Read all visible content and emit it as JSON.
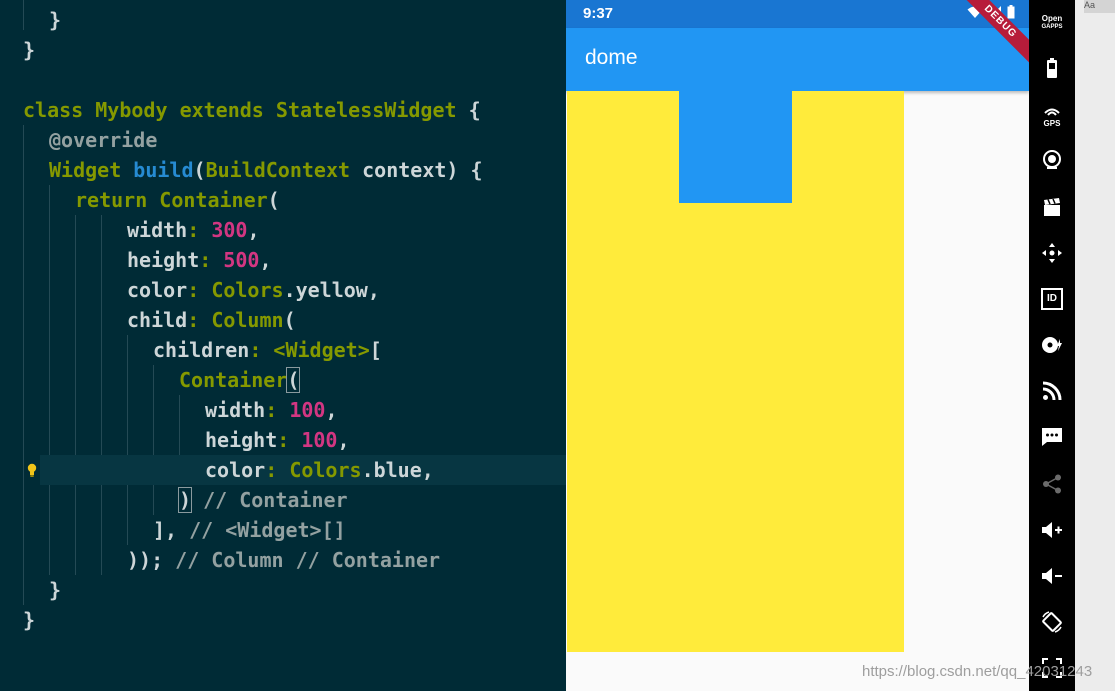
{
  "editor": {
    "tokens": {
      "brace_close": "}",
      "class_kw": "class",
      "class_name": "Mybody",
      "extends_kw": "extends",
      "super_name": "StatelessWidget",
      "open_brace": "{",
      "override": "@override",
      "widget_type": "Widget",
      "build_fn": "build",
      "paren_open": "(",
      "ctx_type": "BuildContext",
      "ctx_name": "context",
      "paren_close_brace": ") {",
      "return_kw": "return",
      "container": "Container",
      "width_key": "width",
      "height_key": "height",
      "color_key": "color",
      "child_key": "child",
      "children_key": "children",
      "colon": ":",
      "comma": ",",
      "val_300": "300",
      "val_500": "500",
      "val_100a": "100",
      "val_100b": "100",
      "colors": "Colors",
      "yellow": ".yellow,",
      "blue": ".blue,",
      "column": "Column",
      "widget_generic": "<Widget>",
      "bracket_open": "[",
      "close_paren": ")",
      "comment_container": "// Container",
      "close_list": "],",
      "comment_widget_list": "// <Widget>[]",
      "close_parens": "));",
      "comment_column_container": "// Column // Container"
    }
  },
  "emulator": {
    "time": "9:37",
    "app_title": "dome",
    "debug_banner": "DEBUG",
    "colors": {
      "status_bar": "#1976d2",
      "app_bar": "#2196f3",
      "yellow": "#ffeb3b",
      "blue": "#2196f3"
    }
  },
  "toolbar": {
    "open_gapps_line1": "Open",
    "open_gapps_line2": "GAPPS",
    "gps_label": "GPS",
    "id_label": "ID",
    "icons": [
      "battery-icon",
      "gps-icon",
      "camera-icon",
      "clapperboard-icon",
      "move-icon",
      "id-icon",
      "disk-icon",
      "rss-icon",
      "message-icon",
      "share-icon",
      "volume-up-icon",
      "volume-down-icon",
      "rotate-icon",
      "fullscreen-icon"
    ]
  },
  "corner_label": "Aa",
  "watermark": "https://blog.csdn.net/qq_42031243"
}
